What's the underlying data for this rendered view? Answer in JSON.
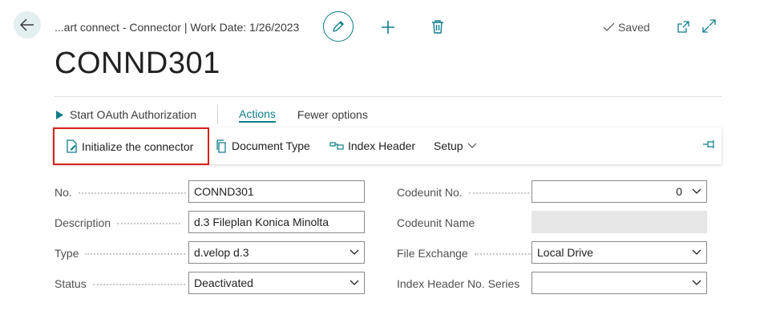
{
  "header": {
    "breadcrumb": "...art connect - Connector | Work Date: 1/26/2023",
    "saved_label": "Saved"
  },
  "page_title": "CONND301",
  "action_bar": {
    "oauth_label": "Start OAuth Authorization",
    "actions_tab": "Actions",
    "fewer_options": "Fewer options"
  },
  "toolbar": {
    "initialize": "Initialize the connector",
    "document_type": "Document Type",
    "index_header": "Index Header",
    "setup": "Setup"
  },
  "fields_left": {
    "no_label": "No.",
    "no_value": "CONND301",
    "description_label": "Description",
    "description_value": "d.3 Fileplan Konica Minolta",
    "type_label": "Type",
    "type_value": "d.velop d.3",
    "status_label": "Status",
    "status_value": "Deactivated"
  },
  "fields_right": {
    "codeunit_no_label": "Codeunit No.",
    "codeunit_no_value": "0",
    "codeunit_name_label": "Codeunit Name",
    "codeunit_name_value": "",
    "file_exchange_label": "File Exchange",
    "file_exchange_value": "Local Drive",
    "index_series_label": "Index Header No. Series",
    "index_series_value": ""
  },
  "colors": {
    "accent": "#0d7e8a",
    "highlight_border": "#d9201c",
    "back_button_bg": "#e3eeef"
  }
}
